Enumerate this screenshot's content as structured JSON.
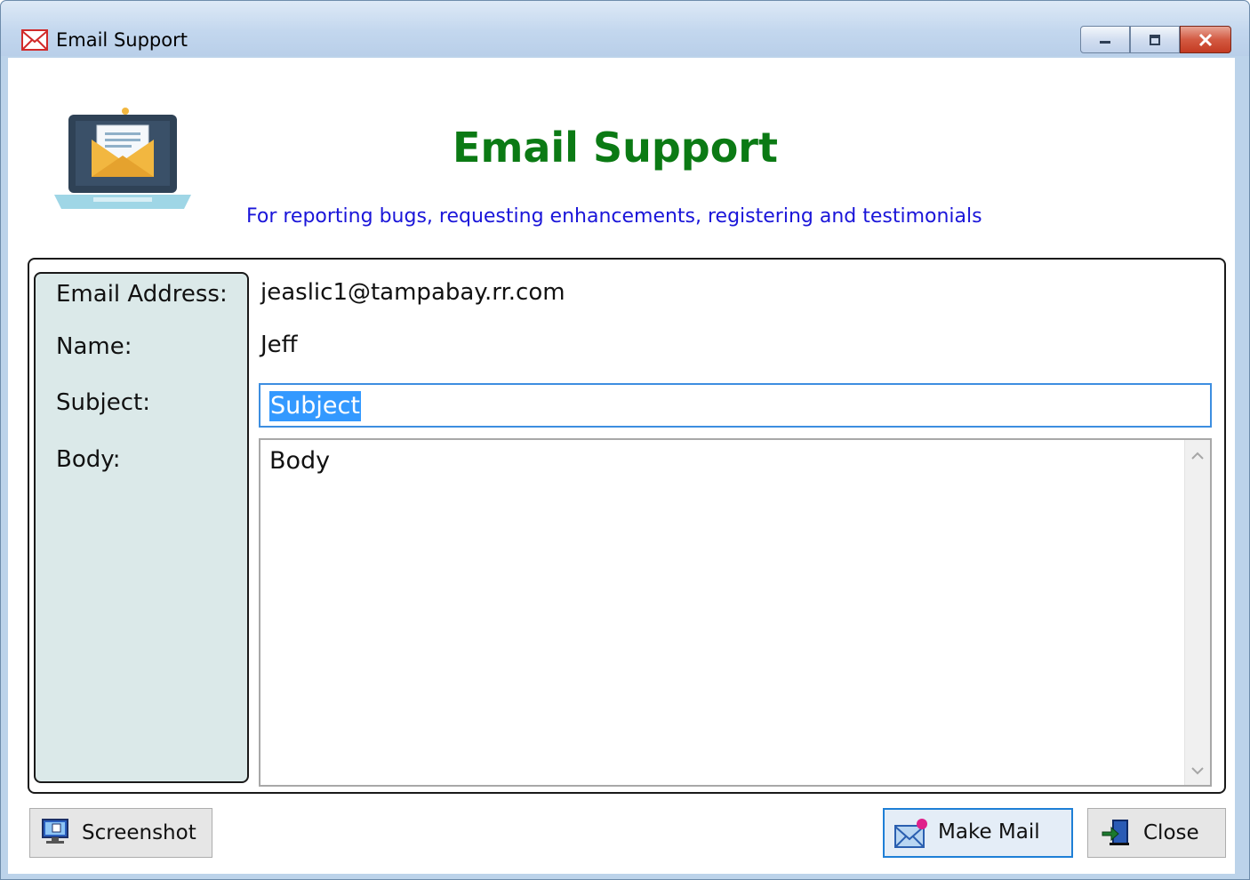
{
  "window": {
    "title": "Email Support",
    "icon": "email-app-icon",
    "controls": [
      "minimize-icon",
      "restore-icon",
      "close-icon"
    ]
  },
  "header": {
    "title": "Email Support",
    "subtitle": "For reporting bugs, requesting enhancements, registering and testimonials",
    "title_color": "#0b7a14",
    "subtitle_color": "#1a15d9",
    "logo_icon": "laptop-email-icon"
  },
  "form": {
    "email_label": "Email Address:",
    "email_value": "jeaslic1@tampabay.rr.com",
    "name_label": "Name:",
    "name_value": "Jeff",
    "subject_label": "Subject:",
    "subject_value": "Subject",
    "body_label": "Body:",
    "body_value": "Body",
    "label_panel_color": "#dbe9e9"
  },
  "buttons": {
    "screenshot": "Screenshot",
    "make_mail": "Make Mail",
    "close": "Close"
  },
  "colors": {
    "focus_border": "#3d8ee0",
    "selection": "#3399ff"
  }
}
